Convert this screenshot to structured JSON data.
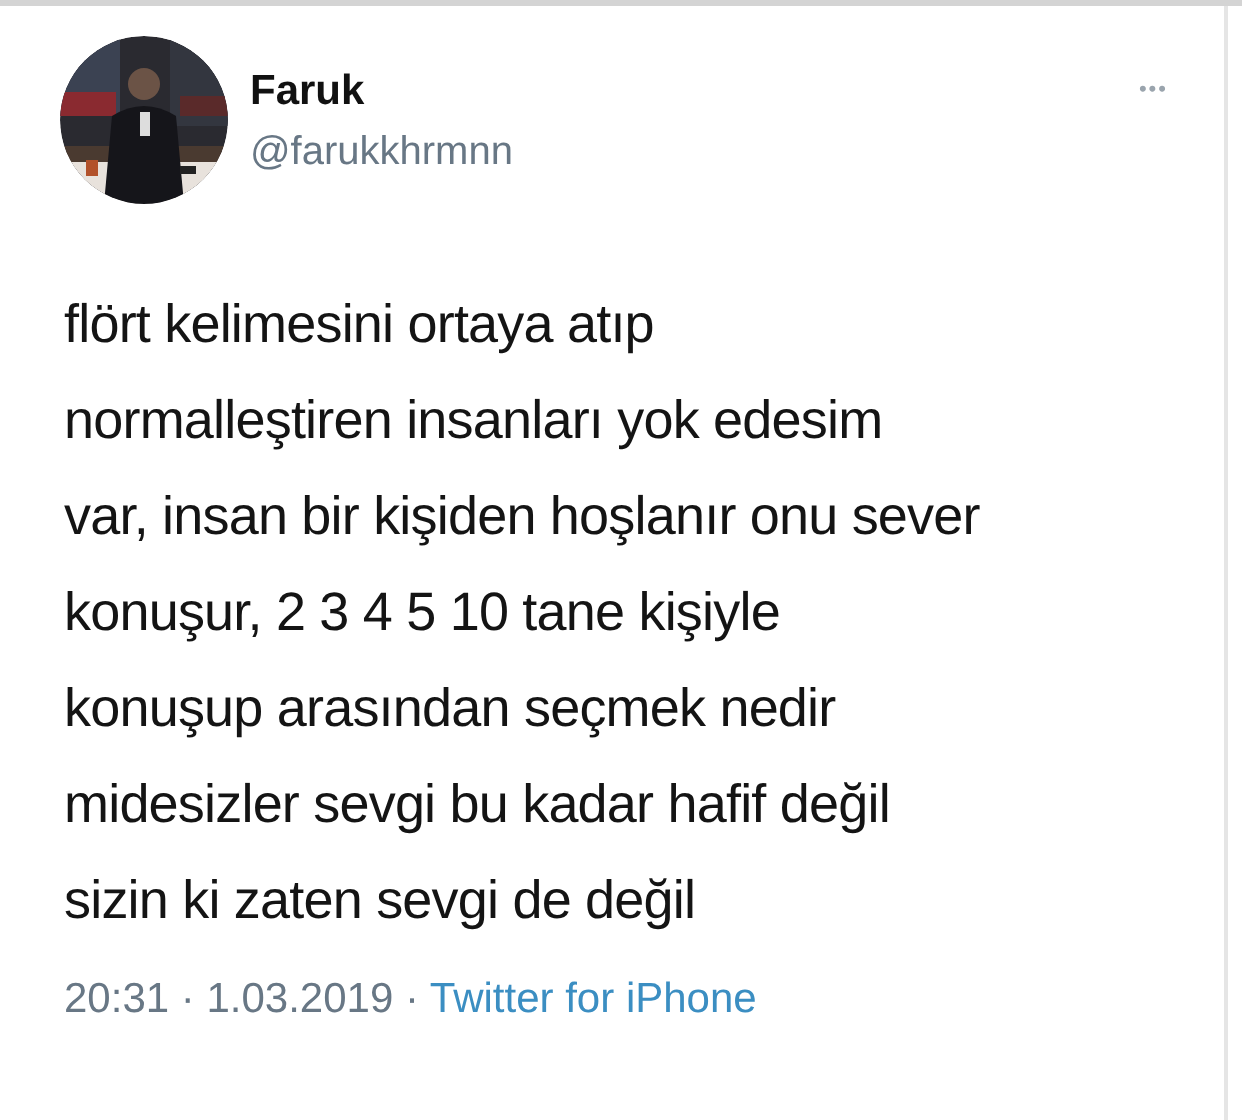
{
  "tweet": {
    "name": "Faruk",
    "handle": "@farukkhrmnn",
    "more": "•••",
    "text_lines": [
      "flört kelimesini ortaya atıp",
      "normalleştiren insanları yok edesim",
      "var, insan bir kişiden hoşlanır onu sever",
      "konuşur, 2 3 4 5 10 tane kişiyle",
      "konuşup arasından seçmek nedir",
      "midesizler sevgi bu kadar hafif değil",
      "sizin ki zaten sevgi de değil"
    ],
    "timestamp": "20:31 · 1.03.2019 · ",
    "source": "Twitter for iPhone"
  }
}
